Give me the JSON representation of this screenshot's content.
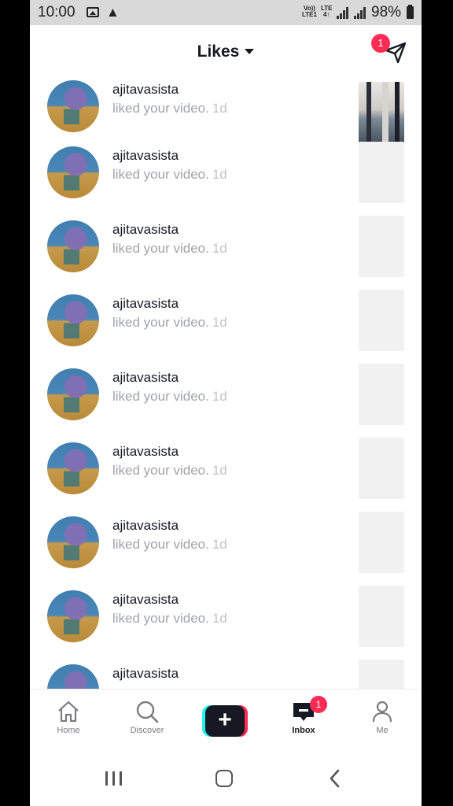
{
  "status_bar": {
    "time": "10:00",
    "volte_line1": "Vo))",
    "volte_line2": "LTE1",
    "lte_line1": "LTE",
    "lte_line2": "4↑",
    "battery": "98%"
  },
  "header": {
    "title": "Likes",
    "badge_count": "1"
  },
  "notifications": [
    {
      "username": "ajitavasista",
      "action": "liked your video.",
      "time": "1d",
      "thumb": "video"
    },
    {
      "username": "ajitavasista",
      "action": "liked your video.",
      "time": "1d",
      "thumb": "blank"
    },
    {
      "username": "ajitavasista",
      "action": "liked your video.",
      "time": "1d",
      "thumb": "blank"
    },
    {
      "username": "ajitavasista",
      "action": "liked your video.",
      "time": "1d",
      "thumb": "blank"
    },
    {
      "username": "ajitavasista",
      "action": "liked your video.",
      "time": "1d",
      "thumb": "blank"
    },
    {
      "username": "ajitavasista",
      "action": "liked your video.",
      "time": "1d",
      "thumb": "blank"
    },
    {
      "username": "ajitavasista",
      "action": "liked your video.",
      "time": "1d",
      "thumb": "blank"
    },
    {
      "username": "ajitavasista",
      "action": "liked your video.",
      "time": "1d",
      "thumb": "blank"
    },
    {
      "username": "ajitavasista",
      "action": "",
      "time": "",
      "thumb": "blank"
    }
  ],
  "bottom_nav": {
    "home": "Home",
    "discover": "Discover",
    "inbox": "Inbox",
    "me": "Me",
    "inbox_badge": "1"
  },
  "colors": {
    "accent": "#fe2c55",
    "cyan": "#25f4ee",
    "text": "#161823",
    "muted": "#a1a3a8"
  }
}
